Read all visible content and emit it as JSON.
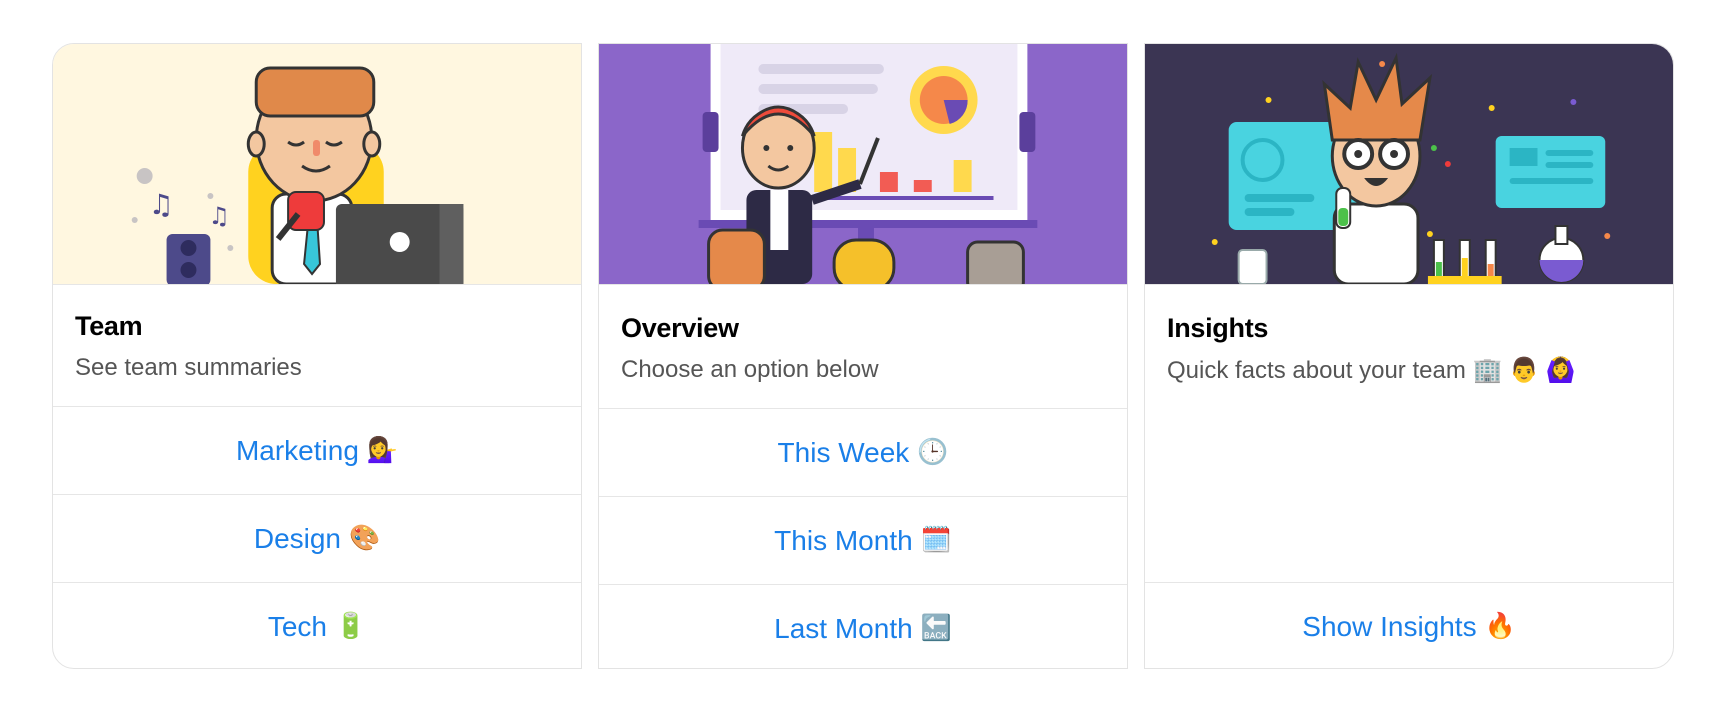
{
  "cards": [
    {
      "title": "Team",
      "subtitle": "See team summaries",
      "buttons": [
        {
          "label": "Marketing",
          "emoji": "💁‍♀️"
        },
        {
          "label": "Design",
          "emoji": "🎨"
        },
        {
          "label": "Tech",
          "emoji": "🔋"
        }
      ]
    },
    {
      "title": "Overview",
      "subtitle": "Choose an option below",
      "buttons": [
        {
          "label": "This Week",
          "emoji": "🕒"
        },
        {
          "label": "This Month",
          "emoji": "🗓️"
        },
        {
          "label": "Last Month",
          "emoji": "🔙"
        }
      ]
    },
    {
      "title": "Insights",
      "subtitle": "Quick facts about your team 🏢 👨 🙆‍♀️",
      "buttons": [
        {
          "label": "Show Insights",
          "emoji": "🔥"
        }
      ]
    }
  ],
  "colors": {
    "link": "#1a7fe8",
    "team_bg": "#fff7e0",
    "overview_bg": "#8b66c9",
    "insights_bg": "#3b3553"
  }
}
